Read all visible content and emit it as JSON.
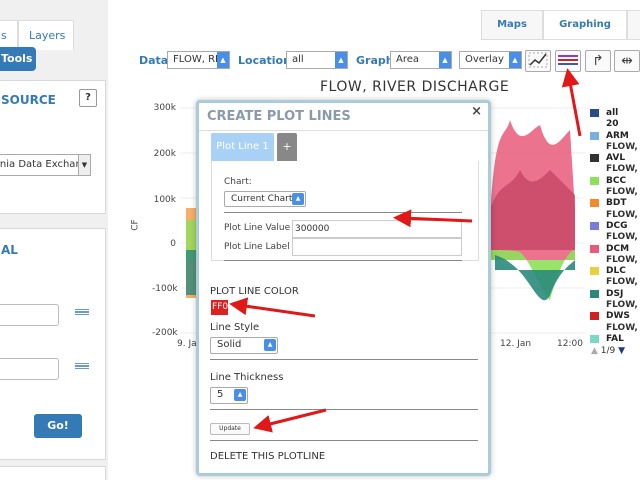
{
  "left_panel": {
    "tab_partial": "s",
    "tab_layers": "Layers",
    "tools_label": "Tools",
    "source_heading": "SOURCE",
    "help_label": "?",
    "source_value": "rnia Data Exchar",
    "section_partial": "AL",
    "go_label": "Go!"
  },
  "top_tabs": {
    "maps": "Maps",
    "graphing": "Graphing"
  },
  "toolbar": {
    "data_label": "Data",
    "data_value": "FLOW, RI",
    "location_label": "Location",
    "location_value": "all",
    "graph_label": "Graph",
    "graph_value": "Area",
    "overlay_value": "Overlay"
  },
  "chart_data": {
    "type": "area",
    "title": "FLOW, RIVER DISCHARGE",
    "ylabel": "CF",
    "y_ticks": [
      "300k",
      "200k",
      "100k",
      "0",
      "-100k",
      "-200k"
    ],
    "x_ticks": [
      "9. Jan",
      "12. Jan",
      "12:00"
    ],
    "ylim": [
      -200000,
      300000
    ],
    "legend": [
      {
        "name": "all",
        "color": "#2b4a8a"
      },
      {
        "name": "20",
        "color": "#1f3d7a"
      },
      {
        "name": "ARM",
        "color": "#7ab0e0"
      },
      {
        "name": "FLOW, F",
        "color": null
      },
      {
        "name": "AVL",
        "color": "#333333"
      },
      {
        "name": "FLOW, F",
        "color": null
      },
      {
        "name": "BCC",
        "color": "#8de05a"
      },
      {
        "name": "FLOW, F",
        "color": null
      },
      {
        "name": "BDT",
        "color": "#f28c28"
      },
      {
        "name": "FLOW, F",
        "color": null
      },
      {
        "name": "DCG",
        "color": "#7a7ad8"
      },
      {
        "name": "FLOW, F",
        "color": null
      },
      {
        "name": "DCM",
        "color": "#e85a7a"
      },
      {
        "name": "FLOW, F",
        "color": null
      },
      {
        "name": "DLC",
        "color": "#e8d040"
      },
      {
        "name": "FLOW, F",
        "color": null
      },
      {
        "name": "DSJ",
        "color": "#2a8a7a"
      },
      {
        "name": "FLOW, F",
        "color": null
      },
      {
        "name": "DWS",
        "color": "#d02020"
      },
      {
        "name": "FLOW, F",
        "color": null
      },
      {
        "name": "FAL",
        "color": "#7ad8c8"
      }
    ],
    "legend_page": "1/9"
  },
  "modal": {
    "title": "CREATE PLOT LINES",
    "close": "×",
    "tab_label": "Plot Line 1",
    "add_tab": "+",
    "chart_label": "Chart:",
    "chart_value": "Current Chart",
    "plot_line_value_label": "Plot Line Value",
    "plot_line_value": "300000",
    "plot_line_label_label": "Plot Line Label",
    "plot_line_label_value": "",
    "color_heading": "PLOT LINE COLOR",
    "color_value": "FF0",
    "line_style_label": "Line Style",
    "line_style_value": "Solid",
    "thickness_label": "Line Thickness",
    "thickness_value": "5",
    "update_label": "Update",
    "delete_label": "DELETE THIS PLOTLINE"
  }
}
